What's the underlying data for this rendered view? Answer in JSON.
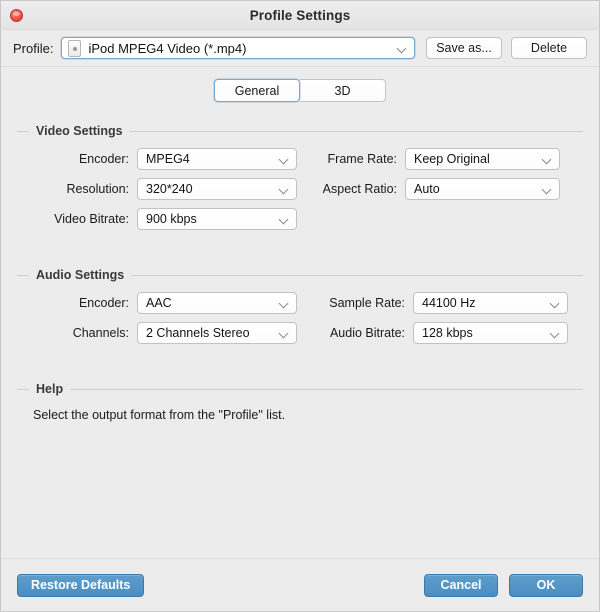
{
  "window": {
    "title": "Profile Settings",
    "close_icon": "close-icon"
  },
  "toolbar": {
    "profile_label": "Profile:",
    "profile_value": "iPod MPEG4 Video (*.mp4)",
    "profile_icon": "ipod-device-icon",
    "save_as_label": "Save as...",
    "delete_label": "Delete"
  },
  "tabs": [
    {
      "label": "General",
      "active": true
    },
    {
      "label": "3D",
      "active": false
    }
  ],
  "video_settings": {
    "title": "Video Settings",
    "encoder_label": "Encoder:",
    "encoder_value": "MPEG4",
    "frame_rate_label": "Frame Rate:",
    "frame_rate_value": "Keep Original",
    "resolution_label": "Resolution:",
    "resolution_value": "320*240",
    "aspect_ratio_label": "Aspect Ratio:",
    "aspect_ratio_value": "Auto",
    "video_bitrate_label": "Video Bitrate:",
    "video_bitrate_value": "900 kbps"
  },
  "audio_settings": {
    "title": "Audio Settings",
    "encoder_label": "Encoder:",
    "encoder_value": "AAC",
    "sample_rate_label": "Sample Rate:",
    "sample_rate_value": "44100 Hz",
    "channels_label": "Channels:",
    "channels_value": "2 Channels Stereo",
    "audio_bitrate_label": "Audio Bitrate:",
    "audio_bitrate_value": "128 kbps"
  },
  "help": {
    "title": "Help",
    "text": "Select the output format from the \"Profile\" list."
  },
  "footer": {
    "restore_defaults_label": "Restore Defaults",
    "cancel_label": "Cancel",
    "ok_label": "OK"
  },
  "colors": {
    "accent_blue": "#4a8ec2",
    "focus_border": "#7aa7cc",
    "window_bg": "#ececec",
    "close_red": "#ef5f56"
  }
}
